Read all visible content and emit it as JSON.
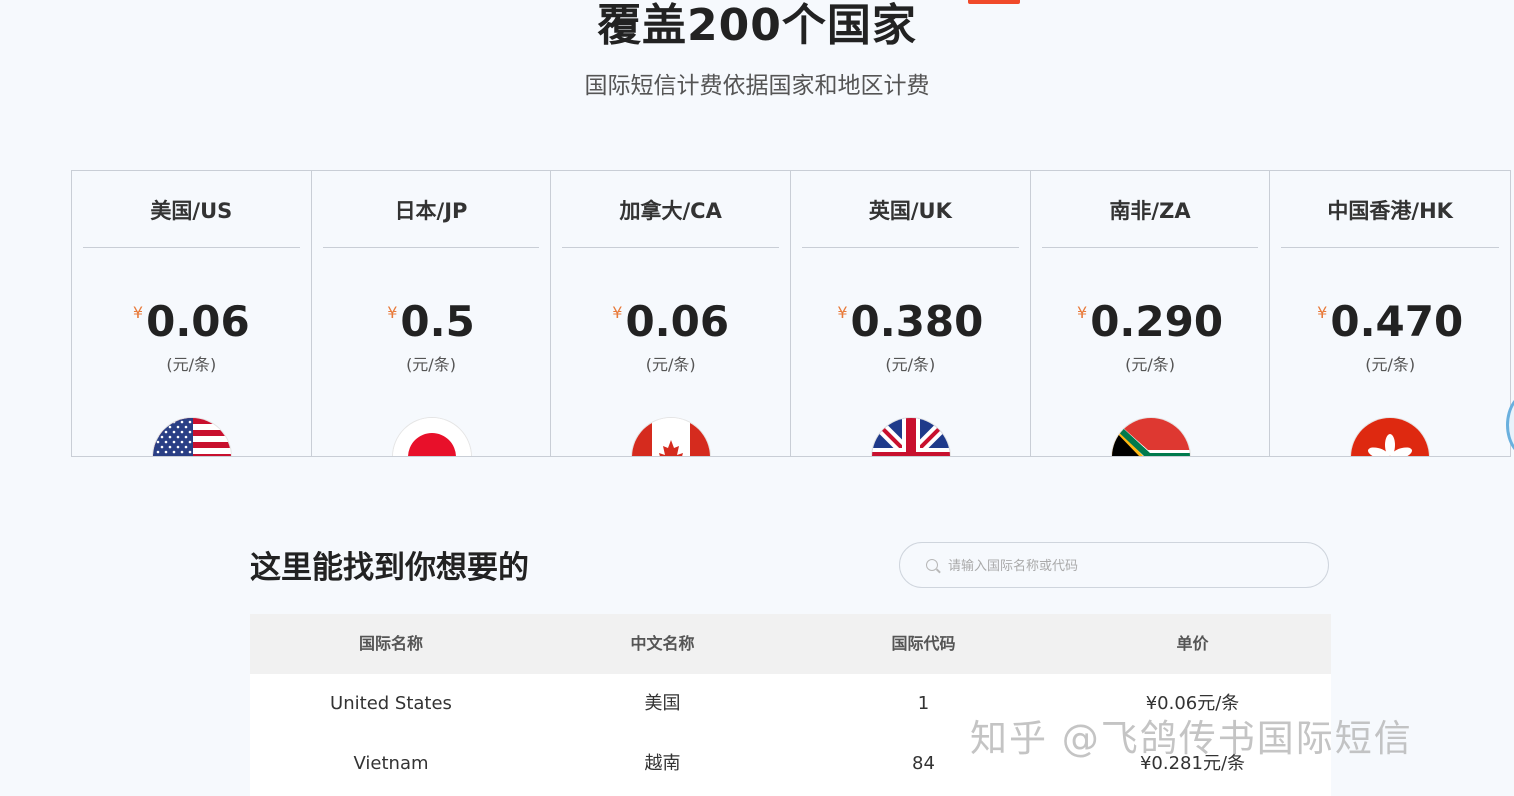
{
  "hero": {
    "title": "覆盖200个国家",
    "subtitle": "国际短信计费依据国家和地区计费"
  },
  "cards": [
    {
      "name": "美国/US",
      "currency": "¥",
      "price": "0.06",
      "unit": "(元/条)",
      "flag": "us-flag-icon"
    },
    {
      "name": "日本/JP",
      "currency": "¥",
      "price": "0.5",
      "unit": "(元/条)",
      "flag": "jp-flag-icon"
    },
    {
      "name": "加拿大/CA",
      "currency": "¥",
      "price": "0.06",
      "unit": "(元/条)",
      "flag": "ca-flag-icon"
    },
    {
      "name": "英国/UK",
      "currency": "¥",
      "price": "0.380",
      "unit": "(元/条)",
      "flag": "uk-flag-icon"
    },
    {
      "name": "南非/ZA",
      "currency": "¥",
      "price": "0.290",
      "unit": "(元/条)",
      "flag": "za-flag-icon"
    },
    {
      "name": "中国香港/HK",
      "currency": "¥",
      "price": "0.470",
      "unit": "(元/条)",
      "flag": "hk-flag-icon"
    }
  ],
  "search": {
    "title": "这里能找到你想要的",
    "placeholder": "请输入国际名称或代码",
    "value": ""
  },
  "table": {
    "headers": [
      "国际名称",
      "中文名称",
      "国际代码",
      "单价"
    ],
    "rows": [
      [
        "United States",
        "美国",
        "1",
        "¥0.06元/条"
      ],
      [
        "Vietnam",
        "越南",
        "84",
        "¥0.281元/条"
      ]
    ]
  },
  "watermark": "知乎 @飞鸽传书国际短信",
  "colors": {
    "accent": "#e87a3a",
    "badge": "#f04a2a",
    "background": "#f6f9fd"
  }
}
